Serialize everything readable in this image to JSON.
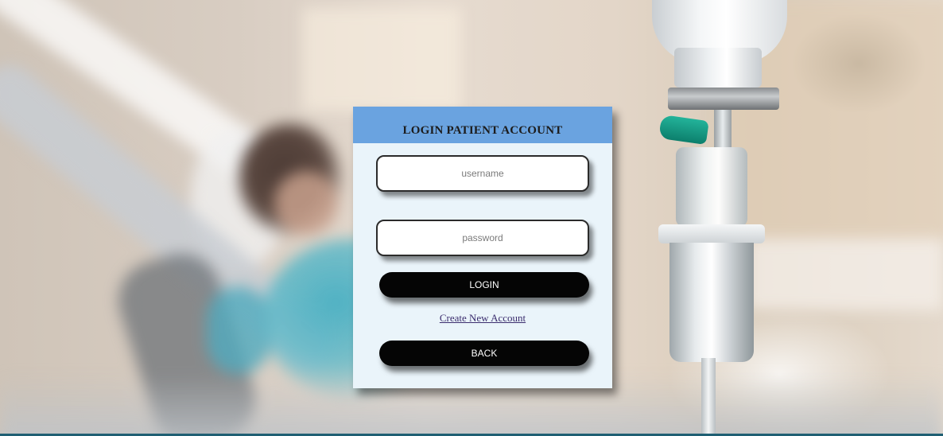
{
  "login_card": {
    "title": "LOGIN PATIENT ACCOUNT",
    "username": {
      "value": "",
      "placeholder": "username"
    },
    "password": {
      "value": "",
      "placeholder": "password"
    },
    "login_button_label": "LOGIN",
    "create_account_link": "Create New Account",
    "back_button_label": "BACK"
  },
  "colors": {
    "header_background": "#6aa3e0",
    "card_background": "#eaf4fa",
    "button_background": "#050505",
    "link_color": "#3b2d6e"
  }
}
